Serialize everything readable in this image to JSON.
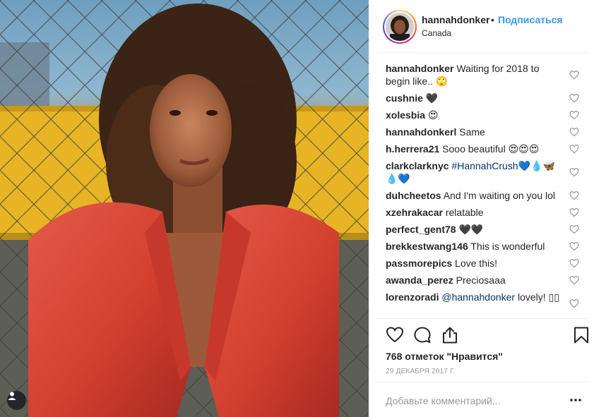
{
  "post": {
    "username": "hannahdonker",
    "dot": "•",
    "follow_label": "Подписаться",
    "location": "Canada"
  },
  "comments": [
    {
      "user": "hannahdonker",
      "text": " Waiting for 2018 to begin like.. 🙄"
    },
    {
      "user": "cushnie",
      "text": " 🖤"
    },
    {
      "user": "xolesbia",
      "text": " 😍"
    },
    {
      "user": "hannahdonkerl",
      "text": " Same"
    },
    {
      "user": "h.herrera21",
      "text": " Sooo beautiful 😍😍😍"
    },
    {
      "user": "clarkclarknyc",
      "text": " ",
      "link": "#HannahCrush",
      "emoji": "💙💧🦋💧💙"
    },
    {
      "user": "duhcheetos",
      "text": " And I'm waiting on you lol"
    },
    {
      "user": "xzehrakacar",
      "text": " relatable"
    },
    {
      "user": "perfect_gent78",
      "text": " 🖤🖤"
    },
    {
      "user": "brekkestwang146",
      "text": " This is wonderful"
    },
    {
      "user": "passmorepics",
      "text": " Love this!"
    },
    {
      "user": "awanda_perez",
      "text": " Preciosaaa"
    },
    {
      "user": "lorenzoradi",
      "text": " ",
      "link": "@hannahdonker",
      "emoji": " lovely! ▯▯"
    }
  ],
  "likes_text": "768 отметок \"Нравится\"",
  "date_text": "29 ДЕКАБРЯ 2017 Г.",
  "add_comment_placeholder": "Добавьте комментарий...",
  "icons": {
    "like": "heart-icon",
    "comment": "comment-icon",
    "share": "share-icon",
    "save": "bookmark-icon",
    "more": "more-icon",
    "user_tag": "user-icon"
  },
  "colors": {
    "accent": "#3897f0",
    "link": "#003569",
    "text": "#262626",
    "muted": "#999999",
    "photo_jacket": "#d8423a"
  }
}
